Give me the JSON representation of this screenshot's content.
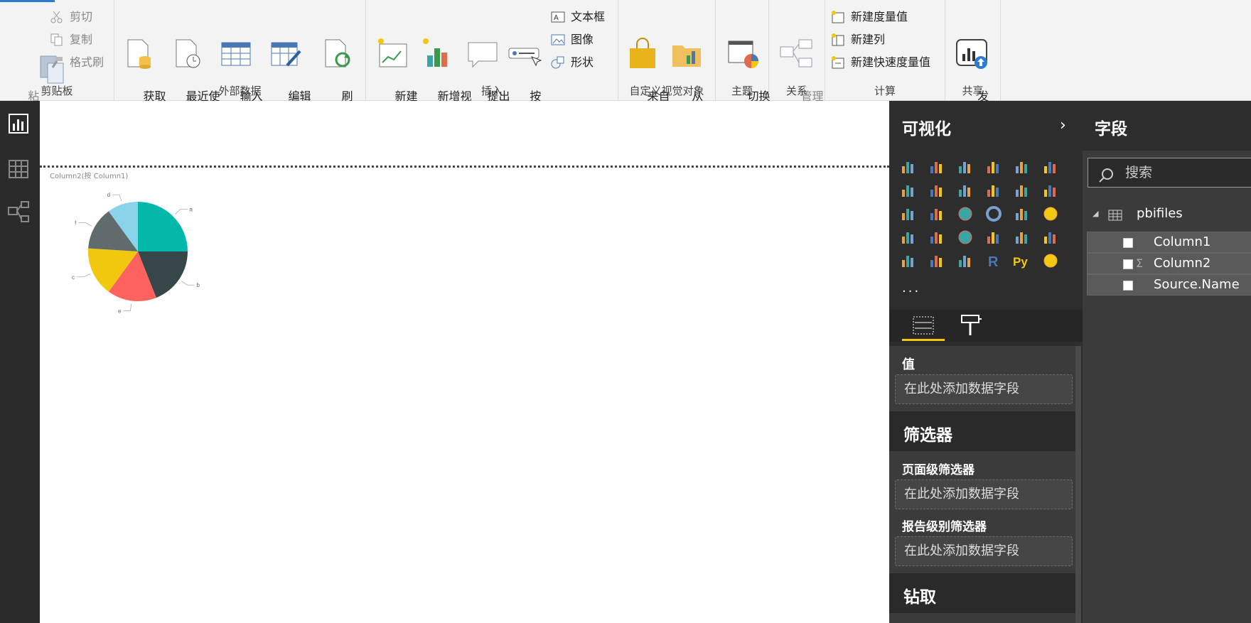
{
  "ribbon": {
    "clipboard": {
      "paste": "粘\n贴",
      "cut": "剪切",
      "copy": "复制",
      "format_painter": "格式刷",
      "group_label": "剪贴板"
    },
    "external_data": {
      "get_data": "获取\n数据",
      "recent_sources": "最近使\n用的源",
      "enter_data": "输入\n数据",
      "edit_queries": "编辑\n查询",
      "refresh": "刷\n新",
      "group_label": "外部数据"
    },
    "insert": {
      "new_page": "新建\n页面",
      "new_visual": "新增视\n觉对象",
      "ask_question": "提出\n问题",
      "buttons": "按\n钮",
      "text_box": "文本框",
      "image": "图像",
      "shapes": "形状",
      "group_label": "插入"
    },
    "custom_visuals": {
      "from_market": "来自\n市场",
      "from_file": "从\n文件",
      "group_label": "自定义视觉对象"
    },
    "themes": {
      "switch_theme": "切换\n主题",
      "group_label": "主题"
    },
    "relationships": {
      "manage": "管理\n关系",
      "group_label": "关系"
    },
    "calculations": {
      "new_measure": "新建度量值",
      "new_column": "新建列",
      "new_quick_measure": "新建快速度量值",
      "group_label": "计算"
    },
    "share": {
      "publish": "发\n布",
      "group_label": "共享"
    }
  },
  "canvas": {
    "chart_title": "Column2(按 Column1)"
  },
  "chart_data": {
    "type": "pie",
    "title": "Column2(按 Column1)",
    "categories": [
      "a",
      "b",
      "e",
      "c",
      "f",
      "d"
    ],
    "values": [
      25,
      19,
      16,
      16,
      14,
      10
    ],
    "colors": [
      "#01b8aa",
      "#374649",
      "#fd625e",
      "#f2c80f",
      "#5f6b6d",
      "#8ad4eb"
    ]
  },
  "viz_pane": {
    "title": "可视化",
    "values_label": "值",
    "drop_placeholder": "在此处添加数据字段",
    "filters_title": "筛选器",
    "page_filters": "页面级筛选器",
    "report_filters": "报告级别筛选器",
    "drillthrough": "钻取",
    "more": "···"
  },
  "fields_pane": {
    "title": "字段",
    "search_placeholder": "搜索",
    "table_name": "pbifiles",
    "fields": [
      "Column1",
      "Column2",
      "Source.Name"
    ],
    "sigma": "Σ"
  },
  "colors": {
    "accent": "#f2c811",
    "dark_pane": "#2d2d2d",
    "ribbon_bg": "#f3f3f3"
  }
}
